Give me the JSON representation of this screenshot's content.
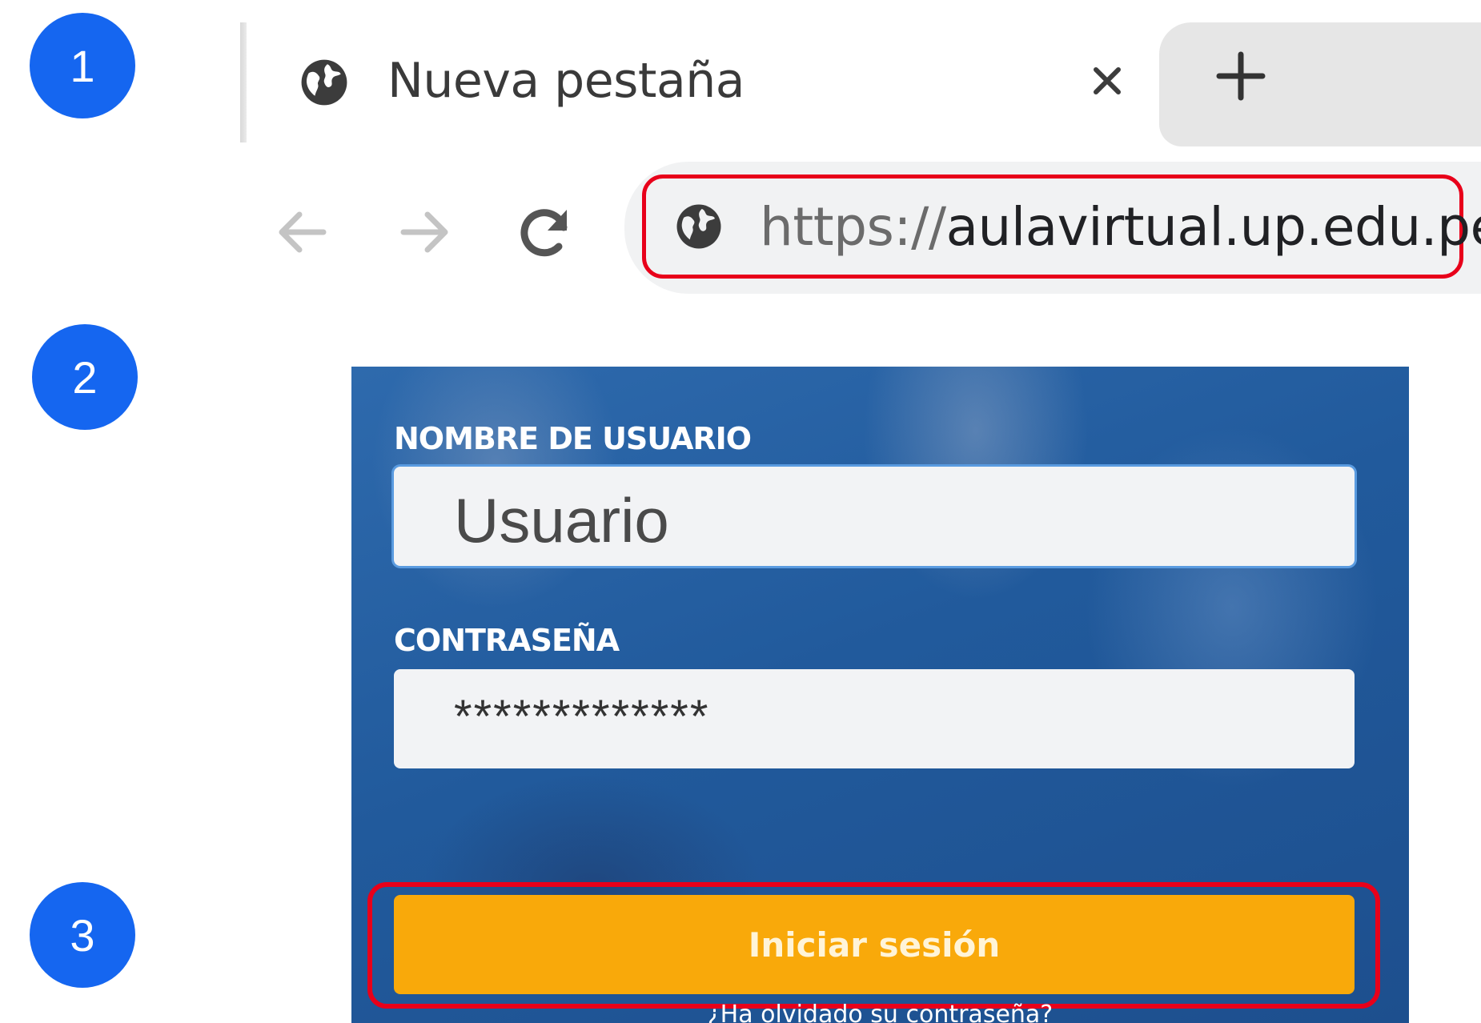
{
  "steps": [
    "1",
    "2",
    "3"
  ],
  "browser": {
    "tab_title": "Nueva pestaña",
    "url_scheme": "https://",
    "url_rest": "aulavirtual.up.edu.pe/"
  },
  "login": {
    "username_label": "NOMBRE DE USUARIO",
    "username_value": "Usuario",
    "password_label": "CONTRASEÑA",
    "password_value": "*************",
    "submit_label": "Iniciar sesión",
    "forgot_label": "¿Ha olvidado su contraseña?"
  },
  "colors": {
    "badge": "#1566f0",
    "highlight": "#e8001a",
    "button": "#f9a90a",
    "panel": "#215a9c"
  }
}
